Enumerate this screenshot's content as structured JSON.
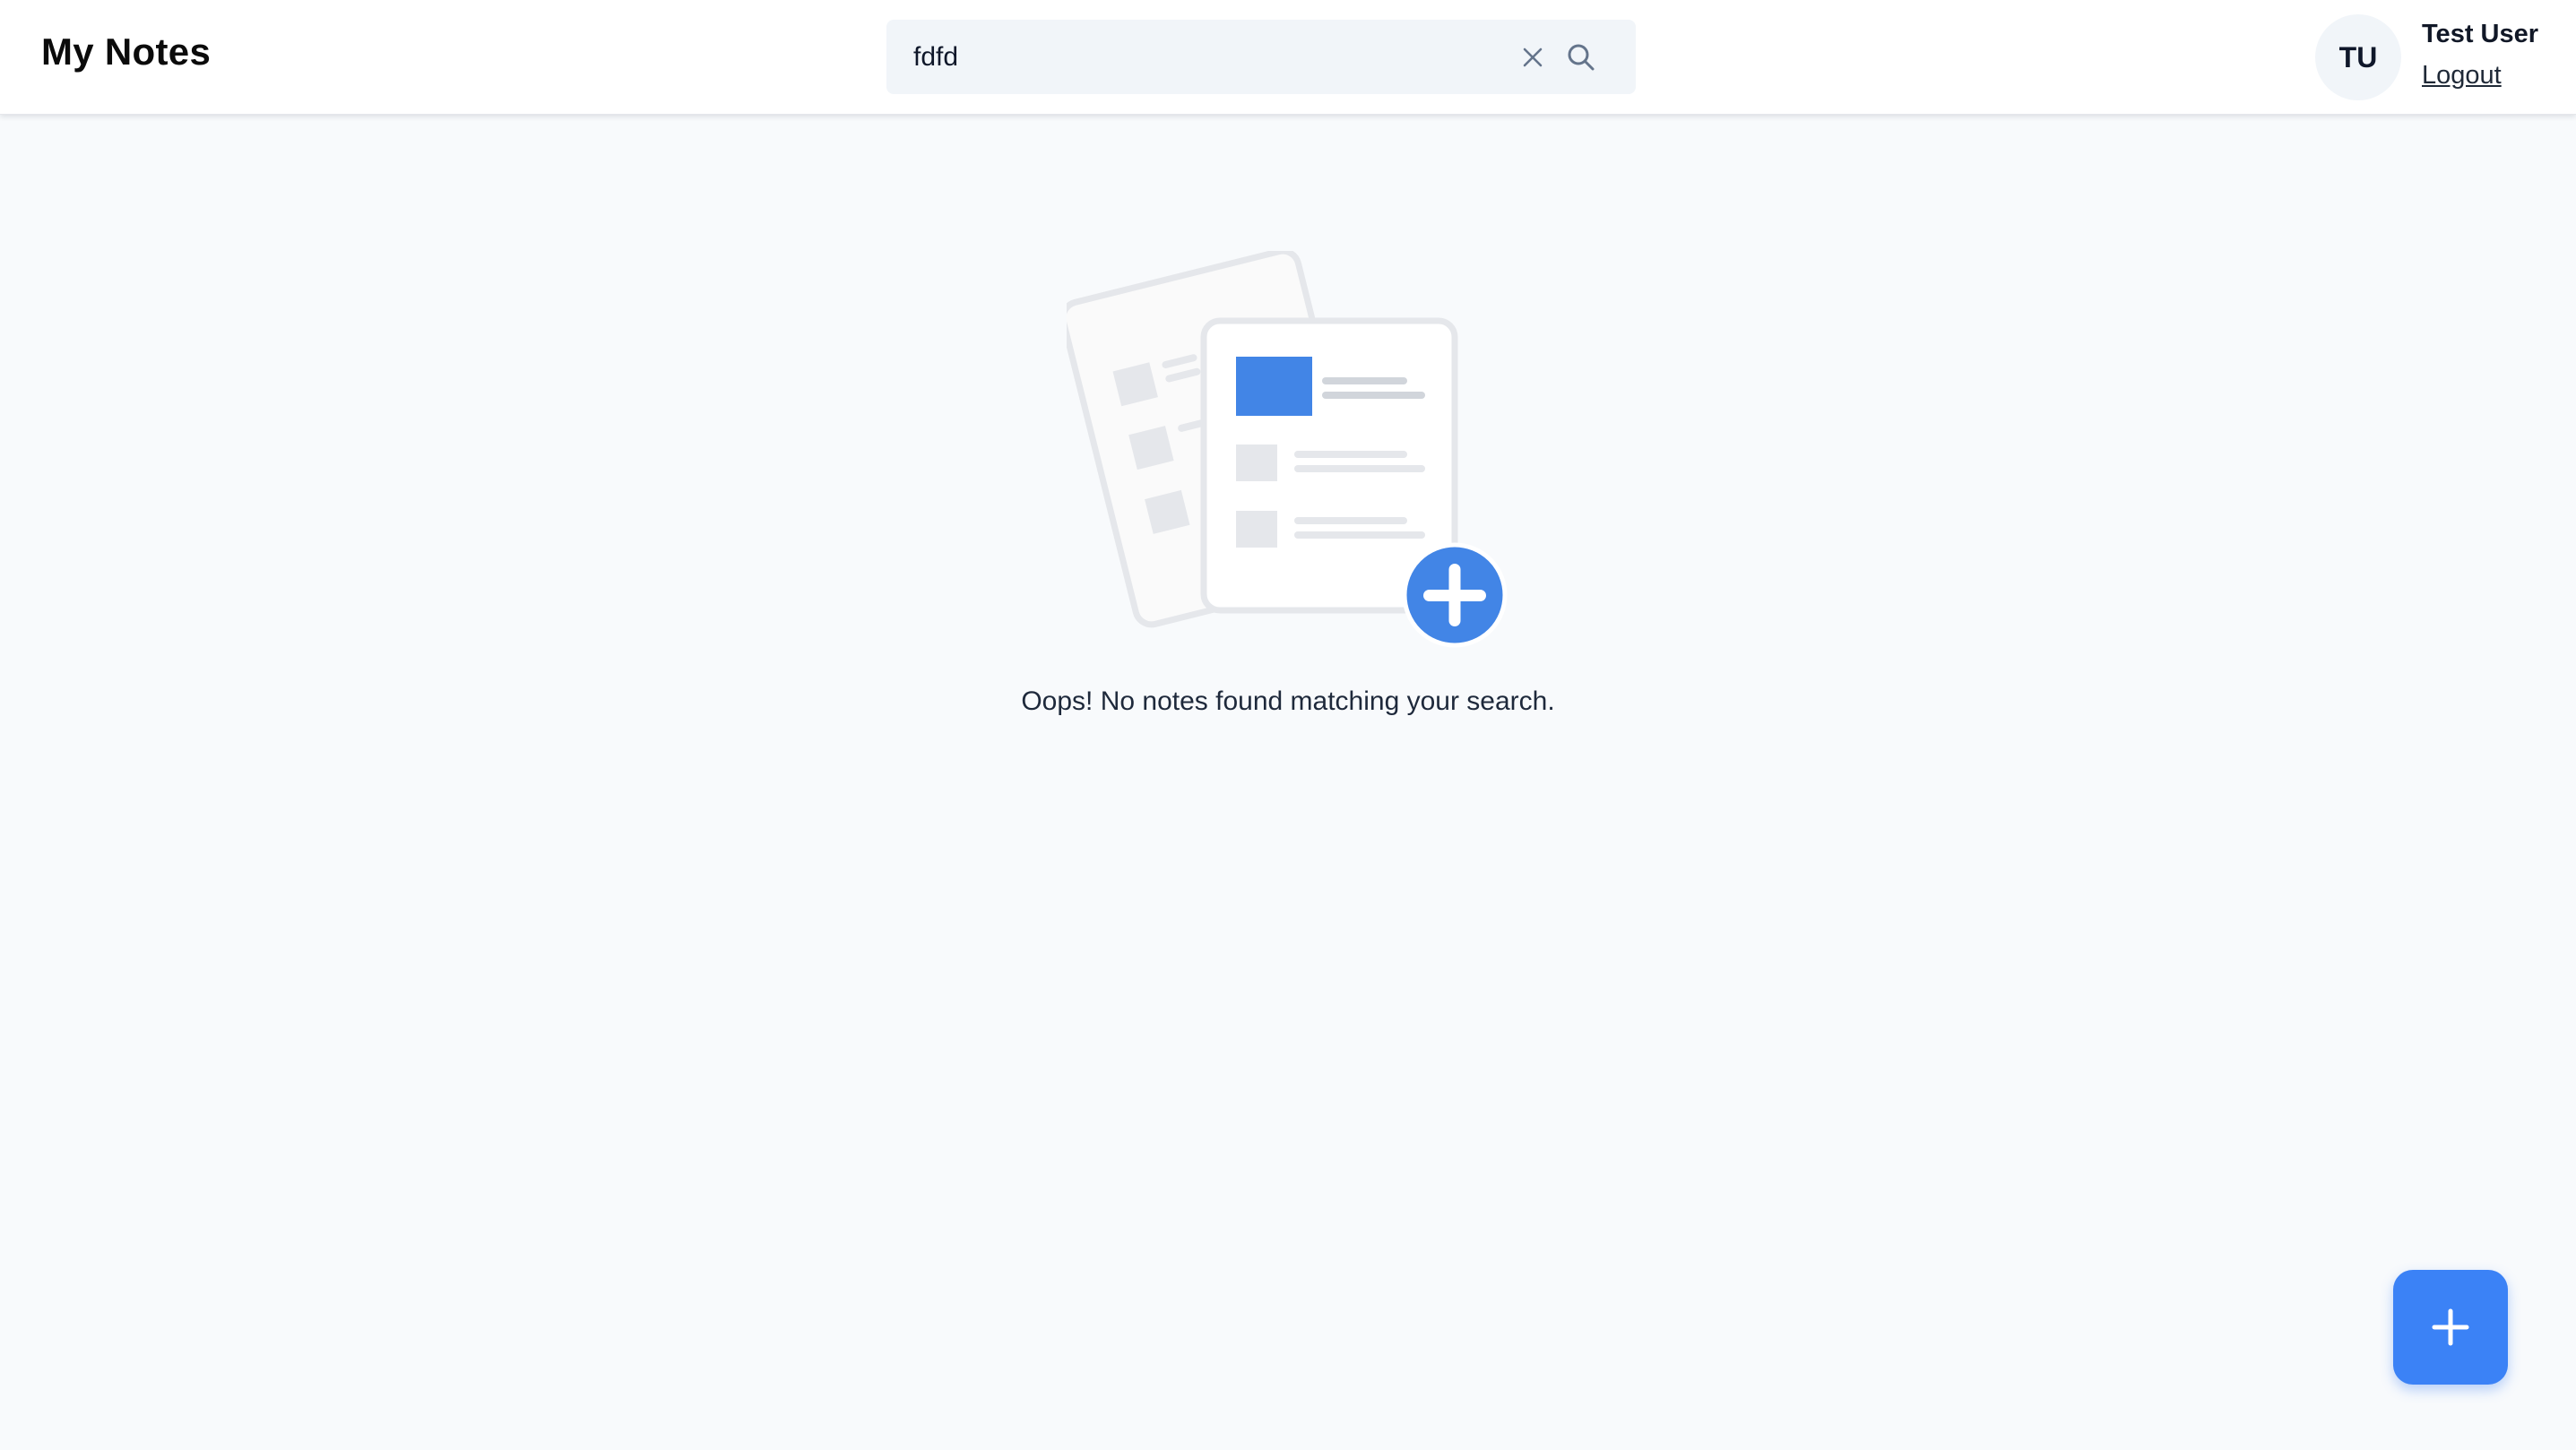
{
  "header": {
    "app_title": "My Notes",
    "search": {
      "value": "fdfd",
      "placeholder": "",
      "clear_icon": "close-icon",
      "search_icon": "search-icon"
    },
    "user": {
      "initials": "TU",
      "name": "Test User",
      "logout_label": "Logout"
    }
  },
  "main": {
    "empty_state_message": "Oops! No notes found matching your search.",
    "illustration_icon": "notes-empty-illustration"
  },
  "fab": {
    "icon": "plus-icon"
  },
  "colors": {
    "accent": "#3b82f6",
    "page_background": "#f8fafc",
    "search_background": "#f1f5f9",
    "illustration_gray": "#e5e7eb"
  }
}
